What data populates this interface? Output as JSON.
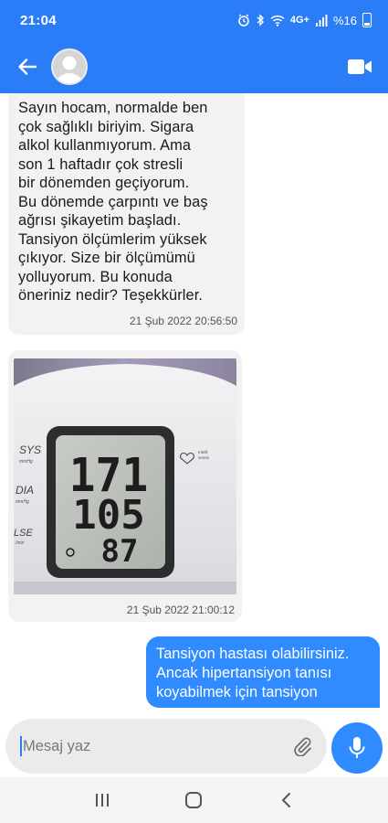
{
  "status_bar": {
    "time": "21:04",
    "battery_text": "%16",
    "network_label": "4G+",
    "icons": [
      "alarm-icon",
      "bluetooth-icon",
      "wifi-icon",
      "volte-icon",
      "signal-icon",
      "battery-icon"
    ]
  },
  "header": {
    "back_icon": "arrow-back-icon",
    "avatar_icon": "default-avatar-icon",
    "video_icon": "video-call-icon",
    "accent_color": "#2a7df6"
  },
  "messages": [
    {
      "direction": "incoming",
      "text": "Sayın hocam, normalde ben\nçok sağlıklı biriyim. Sigara\nalkol kullanmıyorum. Ama\nson 1 haftadır çok stresli\nbir dönemden geçiyorum.\nBu dönemde çarpıntı ve baş\nağrısı şikayetim başladı.\nTansiyon ölçümlerim yüksek\nçıkıyor. Size bir ölçümümü\nyolluyorum. Bu konuda\nöneriniz nedir? Teşekkürler.",
      "timestamp": "21 Şub 2022 20:56:50"
    },
    {
      "direction": "incoming",
      "type": "image",
      "image": {
        "device_labels": {
          "sys": "SYS",
          "sys_unit": "mmHg",
          "dia": "DIA",
          "dia_unit": "mmHg",
          "pulse": "LSE",
          "pulse_unit": "/min",
          "brand_line1": "Intelli",
          "brand_line2": "sense"
        },
        "readings": {
          "sys": "171",
          "dia": "105",
          "pulse": "87"
        }
      },
      "timestamp": "21 Şub 2022 21:00:12"
    },
    {
      "direction": "outgoing",
      "text": "Tansiyon hastası olabilirsiniz.\nAncak hipertansiyon tanısı\nkoyabilmek için tansiyon"
    }
  ],
  "composer": {
    "placeholder": "Mesaj yaz",
    "attach_icon": "paperclip-icon",
    "mic_icon": "microphone-icon",
    "mic_color": "#2f8bff"
  },
  "nav": {
    "icons": [
      "recent-apps-icon",
      "home-icon",
      "back-nav-icon"
    ]
  }
}
